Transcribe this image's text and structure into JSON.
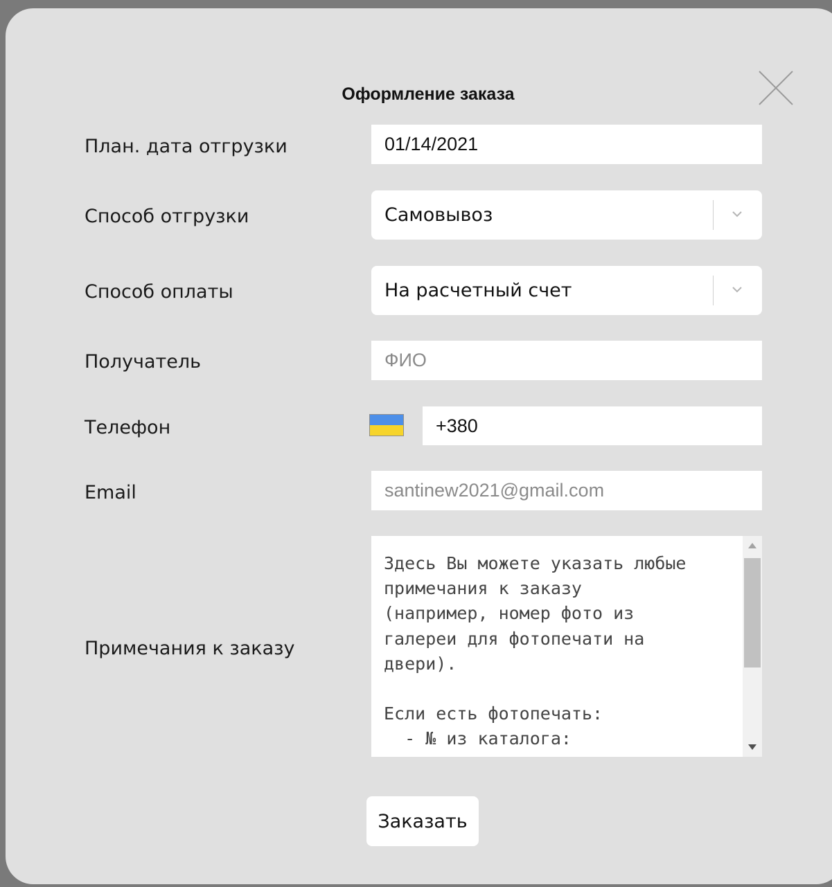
{
  "dialog": {
    "title": "Оформление заказа"
  },
  "form": {
    "ship_date": {
      "label": "План. дата отгрузки",
      "value": "01/14/2021"
    },
    "ship_method": {
      "label": "Способ отгрузки",
      "value": "Самовывоз"
    },
    "payment_method": {
      "label": "Способ оплаты",
      "value": "На расчетный счет"
    },
    "recipient": {
      "label": "Получатель",
      "placeholder": "ФИО"
    },
    "phone": {
      "label": "Телефон",
      "value": "+380",
      "country_flag": "ukraine-flag-icon"
    },
    "email": {
      "label": "Email",
      "value": "santinew2021@gmail.com"
    },
    "notes": {
      "label": "Примечания к заказу",
      "value": "Здесь Вы можете указать любые\nпримечания к заказу\n(например, номер фото из\nгалереи для фотопечати на\nдвери).\n\nЕсли есть фотопечать:\n  - № из каталога:"
    }
  },
  "actions": {
    "submit_label": "Заказать"
  },
  "colors": {
    "backdrop": "#7a7a7a",
    "dialog_bg": "#e0e0e0",
    "field_bg": "#ffffff",
    "flag_blue": "#4d8fe8",
    "flag_yellow": "#f6d42b"
  }
}
